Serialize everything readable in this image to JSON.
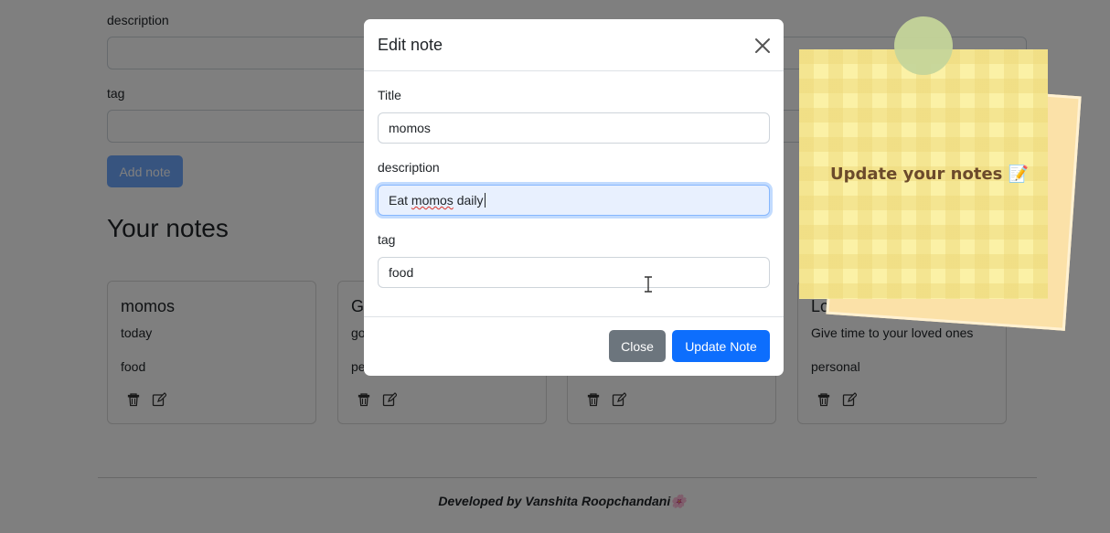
{
  "form": {
    "description_label": "description",
    "tag_label": "tag",
    "add_button": "Add note"
  },
  "notes_section": {
    "title": "Your notes",
    "cards": [
      {
        "title": "momos",
        "description": "today",
        "tag": "food"
      },
      {
        "title": "G",
        "description": "go",
        "tag": "pe"
      },
      {
        "title": "",
        "description": "",
        "tag": ""
      },
      {
        "title": "Lov",
        "description": "Give time to your loved ones",
        "tag": "personal"
      }
    ]
  },
  "modal": {
    "title": "Edit note",
    "title_label": "Title",
    "title_value": "momos",
    "description_label": "description",
    "description_value_word1": "Eat ",
    "description_value_misspelled": "momos",
    "description_value_rest": " daily",
    "tag_label": "tag",
    "tag_value": "food",
    "close_button": "Close",
    "update_button": "Update Note"
  },
  "sticky_note": {
    "text": "Update your notes",
    "emoji": "📝"
  },
  "footer": {
    "text": "Developed by Vanshita Roopchandani",
    "emoji": "🌸"
  },
  "colors": {
    "primary": "#0d6efd",
    "secondary": "#6c757d",
    "backdrop": "rgba(0,0,0,0.5)"
  }
}
